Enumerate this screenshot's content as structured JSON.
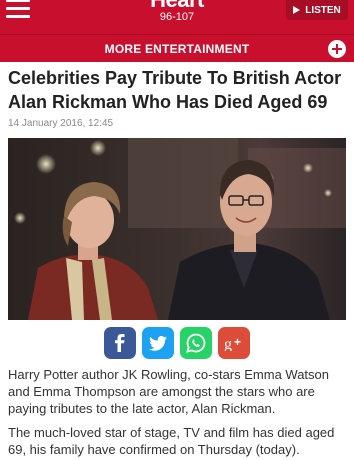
{
  "header": {
    "logo_name": "Heart",
    "logo_frequency": "96-107",
    "listen_label": "LISTEN",
    "brand_color": "#c8102e"
  },
  "section_bar": {
    "label": "MORE ENTERTAINMENT",
    "icon": "plus-circle-icon"
  },
  "article": {
    "headline": "Celebrities Pay Tribute To British Actor Alan Rickman Who Has Died Aged 69",
    "date": "14 January 2016, 12:45",
    "image_alt": "Emma Thompson and Alan Rickman smiling",
    "paragraphs": [
      "Harry Potter author JK Rowling, co-stars Emma Watson and Emma Thompson are amongst the stars who are paying tributes to the late actor, Alan Rickman.",
      "The much-loved star of stage, TV and film has died aged 69, his family have confirmed on Thursday (today)."
    ]
  },
  "share": {
    "buttons": [
      {
        "name": "facebook",
        "label": "f",
        "color": "#3b5998"
      },
      {
        "name": "twitter",
        "label": "twitter",
        "color": "#1da1f2"
      },
      {
        "name": "whatsapp",
        "label": "whatsapp",
        "color": "#25d366"
      },
      {
        "name": "google-plus",
        "label": "g+",
        "color": "#dd4b39"
      }
    ]
  }
}
